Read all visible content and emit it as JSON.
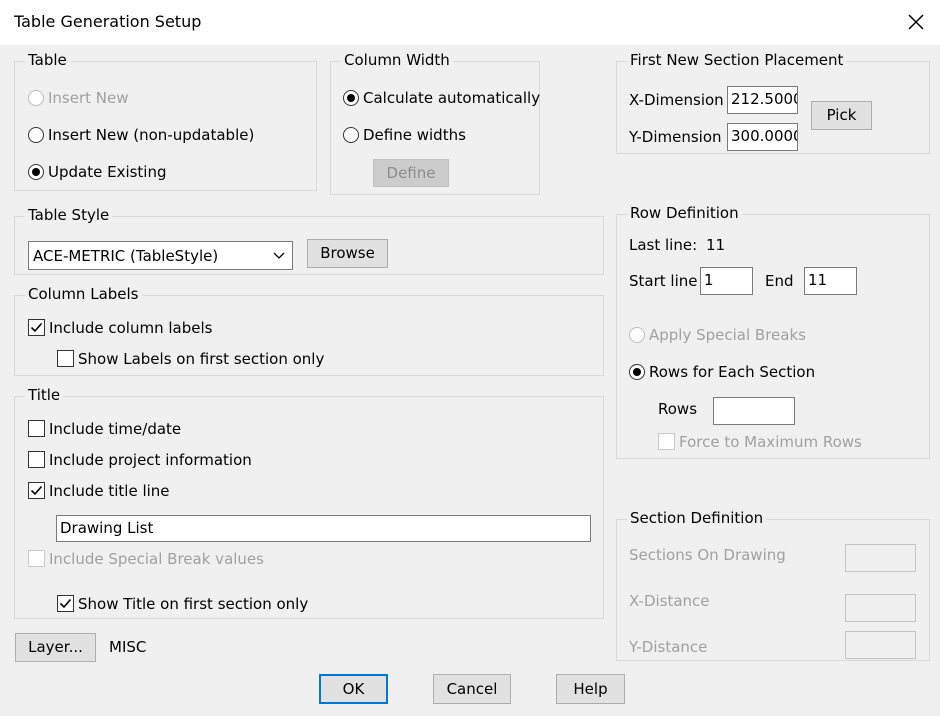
{
  "window": {
    "title": "Table Generation Setup"
  },
  "table_group": {
    "legend": "Table",
    "options": [
      {
        "label": "Insert New",
        "selected": false,
        "disabled": true
      },
      {
        "label": "Insert New (non-updatable)",
        "selected": false,
        "disabled": false
      },
      {
        "label": "Update Existing",
        "selected": true,
        "disabled": false
      }
    ]
  },
  "column_width": {
    "legend": "Column Width",
    "options": [
      {
        "label": "Calculate automatically",
        "selected": true
      },
      {
        "label": "Define widths",
        "selected": false
      }
    ],
    "define_button": "Define"
  },
  "table_style": {
    "legend": "Table Style",
    "selected": "ACE-METRIC  (TableStyle)",
    "browse_button": "Browse"
  },
  "column_labels": {
    "legend": "Column Labels",
    "include": {
      "label": "Include column labels",
      "checked": true
    },
    "first_only": {
      "label": "Show Labels on first section only",
      "checked": false
    }
  },
  "title_group": {
    "legend": "Title",
    "time_date": {
      "label": "Include time/date",
      "checked": false
    },
    "project_info": {
      "label": "Include project information",
      "checked": false
    },
    "title_line": {
      "label": "Include title line",
      "checked": true
    },
    "title_value": "Drawing List",
    "special_break": {
      "label": "Include Special Break values",
      "checked": false,
      "disabled": true
    },
    "first_only": {
      "label": "Show Title on first section only",
      "checked": true
    }
  },
  "layer": {
    "button": "Layer...",
    "value": "MISC"
  },
  "placement": {
    "legend": "First New Section Placement",
    "x_label": "X-Dimension",
    "x_value": "212.5000",
    "y_label": "Y-Dimension",
    "y_value": "300.0000",
    "pick_button": "Pick"
  },
  "row_definition": {
    "legend": "Row Definition",
    "last_line_label": "Last line:",
    "last_line_value": "11",
    "start_label": "Start line",
    "start_value": "1",
    "end_label": "End",
    "end_value": "11",
    "apply_breaks": {
      "label": "Apply Special Breaks",
      "selected": false,
      "disabled": true
    },
    "rows_each": {
      "label": "Rows for Each Section",
      "selected": true
    },
    "rows_label": "Rows",
    "rows_value": "",
    "force_max": {
      "label": "Force to Maximum Rows",
      "checked": false,
      "disabled": true
    }
  },
  "section_definition": {
    "legend": "Section Definition",
    "sections_label": "Sections On Drawing",
    "sections_value": "",
    "x_distance_label": "X-Distance",
    "x_distance_value": "",
    "y_distance_label": "Y-Distance",
    "y_distance_value": ""
  },
  "footer": {
    "ok": "OK",
    "cancel": "Cancel",
    "help": "Help"
  }
}
